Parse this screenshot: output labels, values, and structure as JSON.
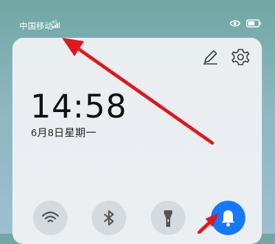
{
  "status_bar": {
    "carrier": "中国移动",
    "signal_badge": "4G"
  },
  "lock_panel": {
    "time": "14:58",
    "date": "6月8日星期一"
  },
  "icons": {
    "edit": "pencil-icon",
    "settings": "gear-icon",
    "wifi": "wifi-icon",
    "bluetooth": "bluetooth-icon",
    "flashlight": "flashlight-icon",
    "notification": "bell-icon",
    "eye": "eye-icon",
    "battery": "battery-icon"
  },
  "colors": {
    "accent": "#1677ff",
    "annotation_arrow": "#e1171e"
  }
}
